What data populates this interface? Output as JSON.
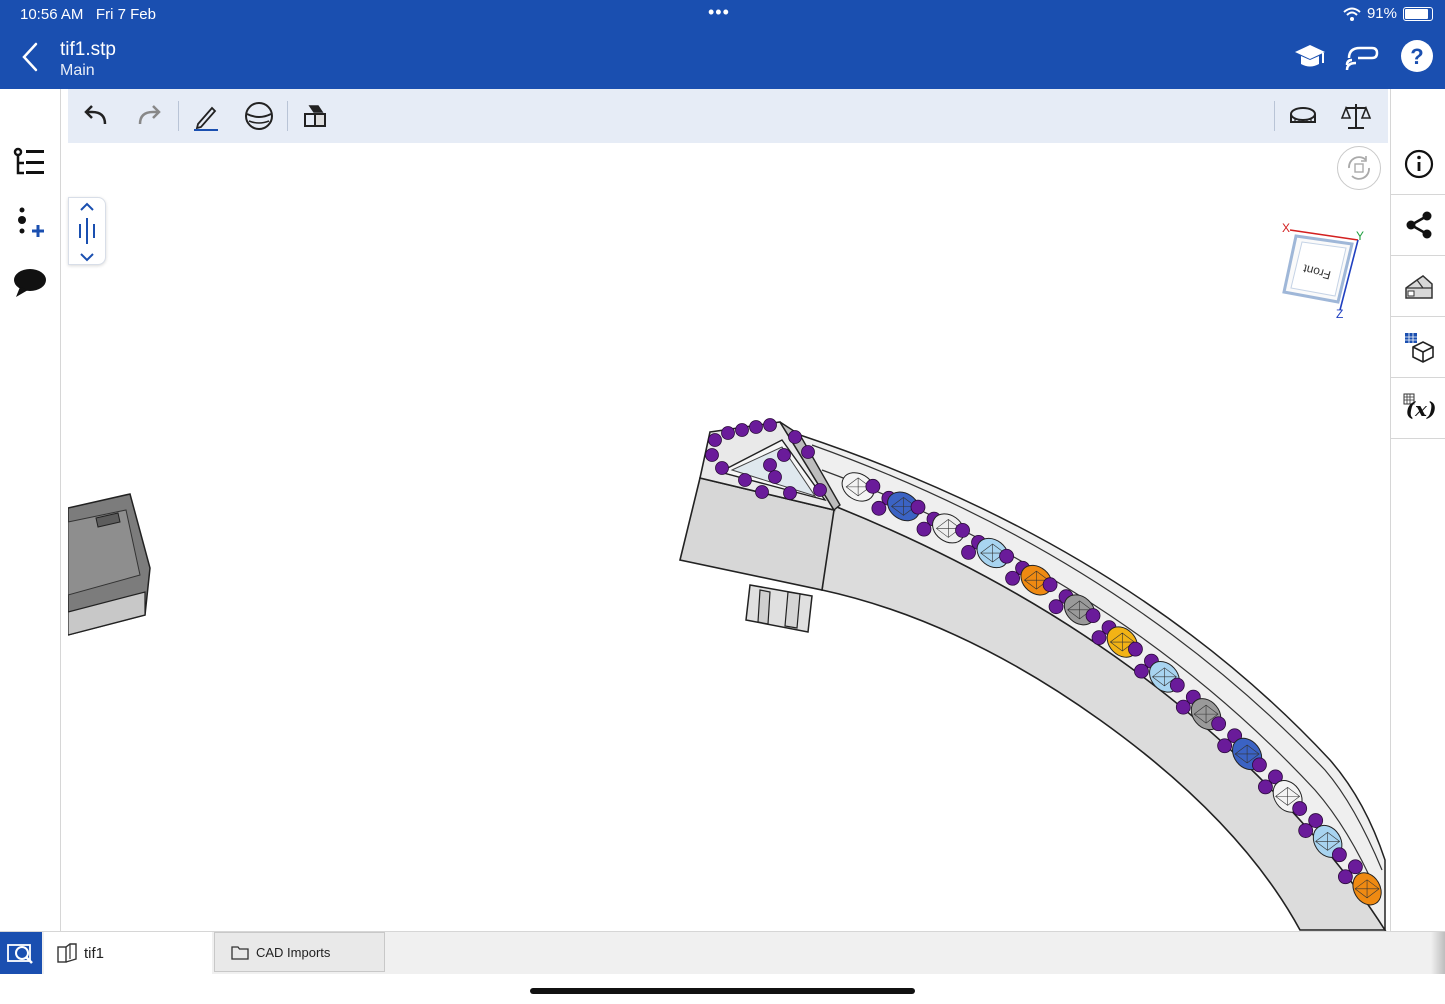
{
  "status_bar": {
    "time": "10:56 AM",
    "date": "Fri 7 Feb",
    "battery": "91%",
    "dots": "•••"
  },
  "header": {
    "title": "tif1.stp",
    "subtitle": "Main"
  },
  "view_cube": {
    "face_label": "Front",
    "axis_x": "X",
    "axis_y": "Y",
    "axis_z": "Z"
  },
  "bottom_bar": {
    "document_tab": "tif1",
    "folder_tab": "CAD Imports"
  },
  "colors": {
    "brand": "#1a4fb0",
    "toolbar": "#e6ecf6",
    "prong": "#6a1b9a"
  },
  "icons": {
    "header": [
      "back-icon",
      "learning-center-icon",
      "cloud-sync-icon",
      "help-icon"
    ],
    "toolbar": [
      "undo-icon",
      "redo-icon",
      "sketch-icon",
      "view-icon",
      "parts-icon",
      "measure-icon",
      "mass-properties-icon"
    ],
    "left_rail": [
      "feature-list-icon",
      "add-mate-icon",
      "comments-icon"
    ],
    "right_rail": [
      "info-icon",
      "share-icon",
      "appearance-icon",
      "configurations-icon",
      "variables-icon"
    ]
  }
}
